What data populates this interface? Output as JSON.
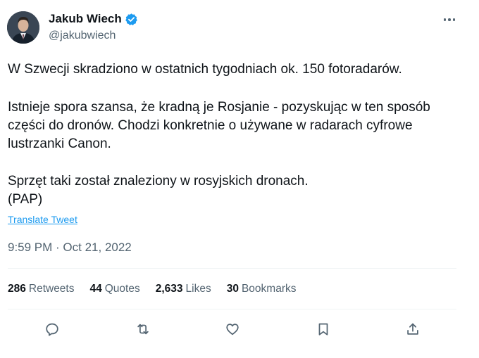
{
  "author": {
    "display_name": "Jakub Wiech",
    "handle": "@jakubwiech",
    "verified": true,
    "avatar_icon": "person-avatar"
  },
  "tweet": {
    "lines": [
      "W Szwecji skradziono w ostatnich tygodniach ok. 150 fotoradarów.",
      "Istnieje spora szansa, że kradną je Rosjanie - pozyskując w ten sposób",
      "części do dronów. Chodzi konkretnie o używane w radarach cyfrowe",
      "lustrzanki Canon.",
      "Sprzęt taki został znaleziony w rosyjskich dronach.",
      "(PAP)"
    ],
    "translate_label": "Translate Tweet",
    "timestamp": "9:59 PM · Oct 21, 2022"
  },
  "stats": {
    "retweets": {
      "count": "286",
      "label": "Retweets"
    },
    "quotes": {
      "count": "44",
      "label": "Quotes"
    },
    "likes": {
      "count": "2,633",
      "label": "Likes"
    },
    "bookmarks": {
      "count": "30",
      "label": "Bookmarks"
    }
  },
  "actions": [
    "reply-icon",
    "retweet-icon",
    "like-icon",
    "bookmark-icon",
    "share-icon"
  ],
  "colors": {
    "text": "#0f1419",
    "secondary": "#536471",
    "link": "#1d9bf0",
    "divider": "#eff3f4",
    "verified": "#1d9bf0"
  }
}
